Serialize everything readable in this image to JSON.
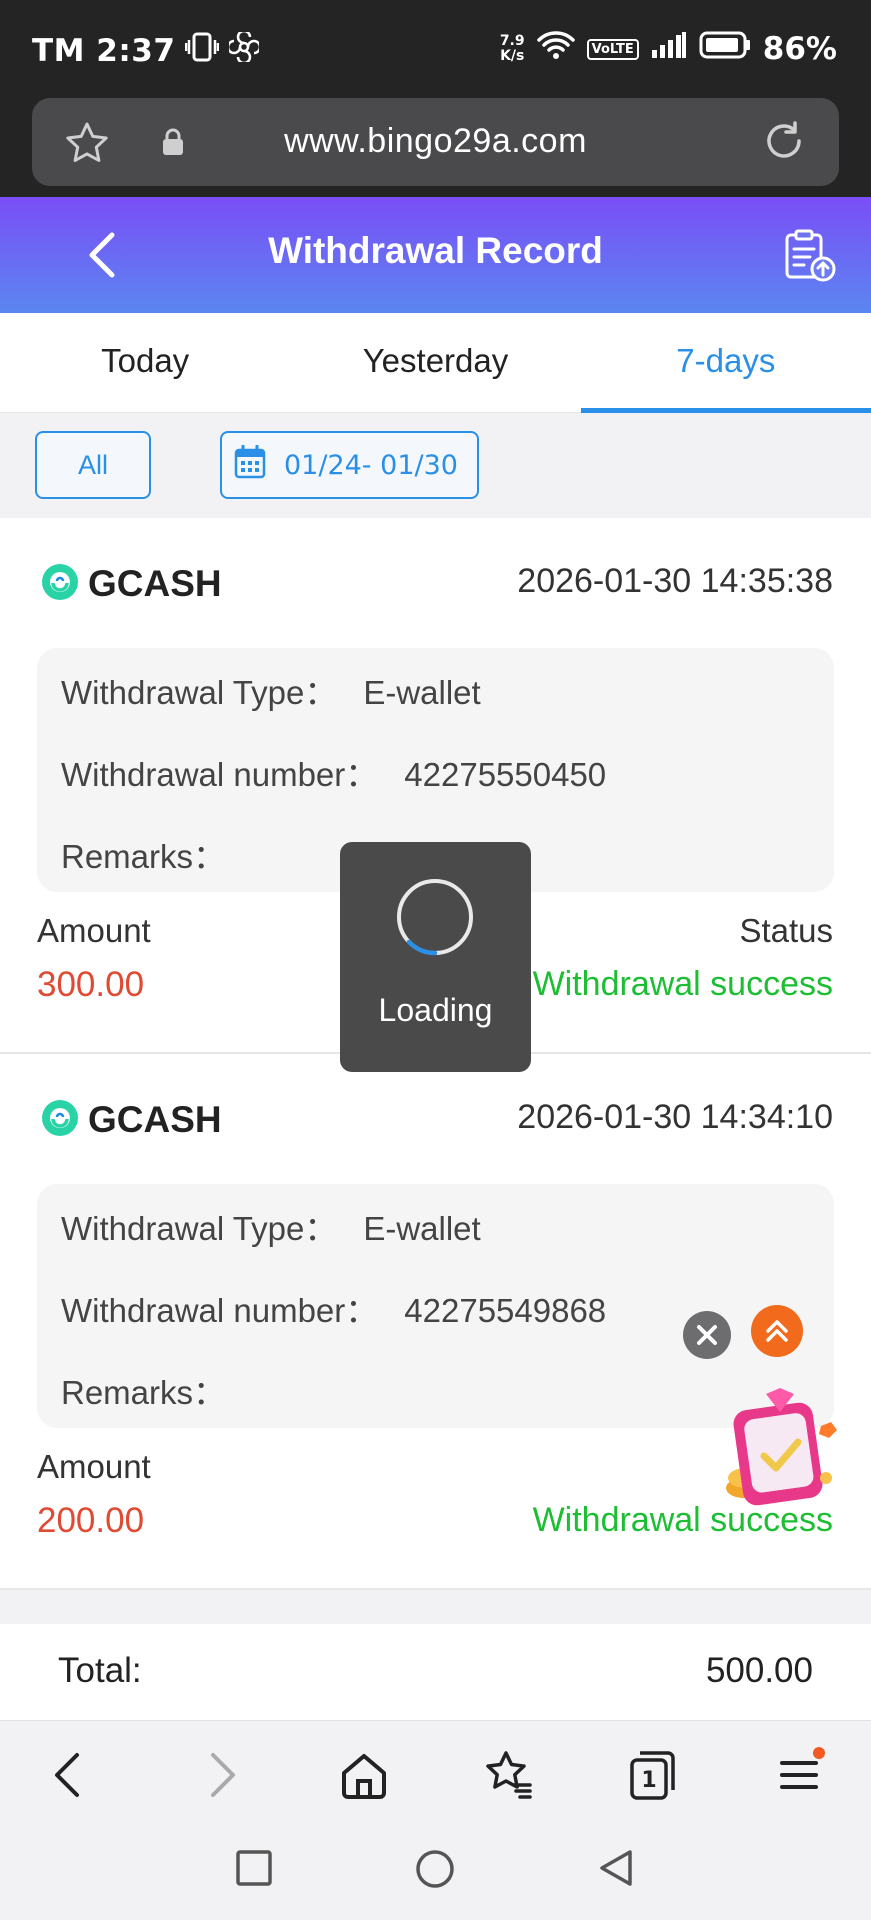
{
  "status_bar": {
    "time": "TM 2:37",
    "net_speed_top": "7.9",
    "net_speed_bottom": "K/s",
    "volte": "VoLTE",
    "battery": "86%"
  },
  "browser": {
    "url": "www.bingo29a.com"
  },
  "header": {
    "title": "Withdrawal Record"
  },
  "tabs": [
    {
      "label": "Today",
      "active": false
    },
    {
      "label": "Yesterday",
      "active": false
    },
    {
      "label": "7-days",
      "active": true
    }
  ],
  "filters": {
    "all_label": "All",
    "date_range": "01/24- 01/30"
  },
  "labels": {
    "withdrawal_type": "Withdrawal Type：",
    "withdrawal_number": "Withdrawal number：",
    "remarks": "Remarks：",
    "amount": "Amount",
    "status": "Status"
  },
  "records": [
    {
      "method": "GCASH",
      "datetime": "2026-01-30 14:35:38",
      "type": "E-wallet",
      "number": "42275550450",
      "remarks": "",
      "amount": "300.00",
      "status": "Withdrawal success"
    },
    {
      "method": "GCASH",
      "datetime": "2026-01-30 14:34:10",
      "type": "E-wallet",
      "number": "42275549868",
      "remarks": "",
      "amount": "200.00",
      "status": "Withdrawal success"
    }
  ],
  "total": {
    "label": "Total:",
    "value": "500.00"
  },
  "loading": {
    "text": "Loading"
  },
  "colors": {
    "accent": "#2a8fe6",
    "amount": "#e04a32",
    "success": "#1ebe34",
    "header_gradient_top": "#7a4ef7",
    "header_gradient_bottom": "#5b86f0"
  },
  "browser_nav": {
    "tab_count": "1"
  }
}
